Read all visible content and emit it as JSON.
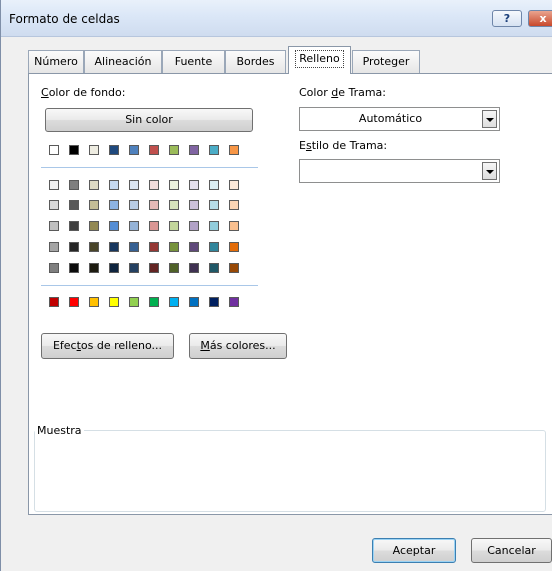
{
  "window": {
    "title": "Formato de celdas",
    "help_label": "?",
    "close_label": "x"
  },
  "tabs": [
    {
      "label": "Número",
      "active": false
    },
    {
      "label": "Alineación",
      "active": false
    },
    {
      "label": "Fuente",
      "active": false
    },
    {
      "label": "Bordes",
      "active": false
    },
    {
      "label": "Relleno",
      "active": true
    },
    {
      "label": "Proteger",
      "active": false
    }
  ],
  "background": {
    "label_first": "C",
    "label_rest": "olor de fondo:",
    "no_color_label": "Sin color",
    "standard_row": [
      "#ffffff",
      "#000000",
      "#eeece1",
      "#1f497d",
      "#4f81bd",
      "#c0504d",
      "#9bbb59",
      "#8064a2",
      "#4bacc6",
      "#f79646"
    ],
    "theme_rows": [
      [
        "#f2f2f2",
        "#7f7f7f",
        "#ddd9c3",
        "#c6d9f0",
        "#dbe5f1",
        "#f2dcdb",
        "#ebf1dd",
        "#e5e0ec",
        "#dbeef3",
        "#fdeada"
      ],
      [
        "#d8d8d8",
        "#595959",
        "#c4bd97",
        "#8db3e2",
        "#b8cce4",
        "#e5b9b7",
        "#d7e3bc",
        "#ccc1d9",
        "#b7dde8",
        "#fbd5b5"
      ],
      [
        "#bfbfbf",
        "#3f3f3f",
        "#938953",
        "#548dd4",
        "#95b3d7",
        "#d99694",
        "#c3d69b",
        "#b2a2c7",
        "#92cddc",
        "#fac08f"
      ],
      [
        "#a5a5a5",
        "#262626",
        "#494429",
        "#17365d",
        "#366092",
        "#953734",
        "#76923c",
        "#5f497a",
        "#31859b",
        "#e36c09"
      ],
      [
        "#7f7f7f",
        "#0c0c0c",
        "#1d1b10",
        "#0f243e",
        "#244061",
        "#632423",
        "#4f6128",
        "#3f3151",
        "#205867",
        "#974806"
      ]
    ],
    "standard_colors": [
      "#c00000",
      "#ff0000",
      "#ffc000",
      "#ffff00",
      "#92d050",
      "#00b050",
      "#00b0f0",
      "#0070c0",
      "#002060",
      "#7030a0"
    ],
    "fill_effects_pre": "Efec",
    "fill_effects_u": "t",
    "fill_effects_post": "os de relleno...",
    "more_colors_u": "M",
    "more_colors_post": "ás colores..."
  },
  "pattern": {
    "color_label_pre": "Color ",
    "color_label_u": "d",
    "color_label_post": "e Trama:",
    "color_value": "Automático",
    "style_label_pre": "E",
    "style_label_u": "s",
    "style_label_post": "tilo de Trama:",
    "style_value": ""
  },
  "sample": {
    "label": "Muestra"
  },
  "footer": {
    "ok_label": "Aceptar",
    "cancel_label": "Cancelar"
  }
}
